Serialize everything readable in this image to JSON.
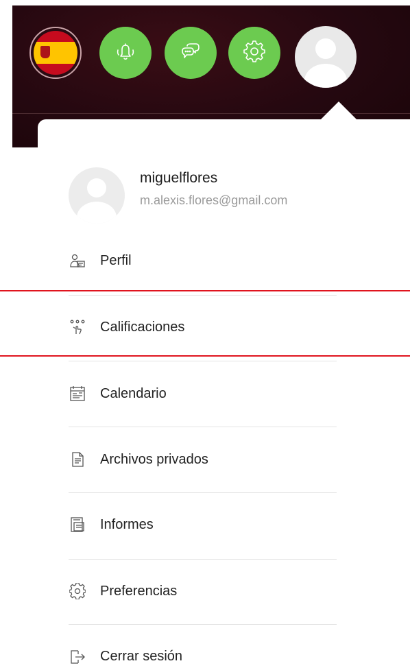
{
  "header": {
    "language_flag": "spain-flag-icon",
    "buttons": [
      {
        "icon": "bell-icon"
      },
      {
        "icon": "chat-icon"
      },
      {
        "icon": "gear-icon"
      }
    ],
    "accent_color": "#6ccb50"
  },
  "user": {
    "username": "miguelflores",
    "email": "m.alexis.flores@gmail.com"
  },
  "menu": {
    "items": [
      {
        "label": "Perfil",
        "icon": "profile-icon"
      },
      {
        "label": "Calificaciones",
        "icon": "grades-icon"
      },
      {
        "label": "Calendario",
        "icon": "calendar-icon"
      },
      {
        "label": "Archivos privados",
        "icon": "file-icon"
      },
      {
        "label": "Informes",
        "icon": "reports-icon"
      },
      {
        "label": "Preferencias",
        "icon": "gear-icon"
      },
      {
        "label": "Cerrar sesión",
        "icon": "logout-icon"
      }
    ]
  },
  "highlight_color": "#e0141e"
}
